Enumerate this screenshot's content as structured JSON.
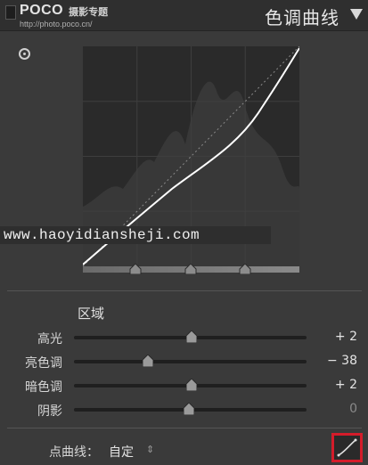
{
  "header": {
    "brand_logo": "POCO",
    "brand_subtitle": "摄影专题",
    "brand_url": "http://photo.poco.cn/",
    "title": "色调曲线"
  },
  "watermark": "www.haoyidiansheji.com",
  "region": {
    "title": "区域",
    "sliders": [
      {
        "label": "高光",
        "value": "+ 2",
        "level": 2,
        "dim": false
      },
      {
        "label": "亮色调",
        "value": "− 38",
        "level": -38,
        "dim": false
      },
      {
        "label": "暗色调",
        "value": "+ 2",
        "level": 2,
        "dim": false
      },
      {
        "label": "阴影",
        "value": "0",
        "level": 0,
        "dim": true
      }
    ]
  },
  "point_curve": {
    "label": "点曲线：",
    "value": "自定",
    "toggle": "⇕"
  },
  "colors": {
    "accent_highlight": "#d41c2a",
    "curve": "#ffffff",
    "graph_bg": "#2a2a2a"
  },
  "icons": [
    "target-adjust-icon",
    "panel-menu-icon",
    "point-curve-edit-icon",
    "split-handle-icon"
  ]
}
